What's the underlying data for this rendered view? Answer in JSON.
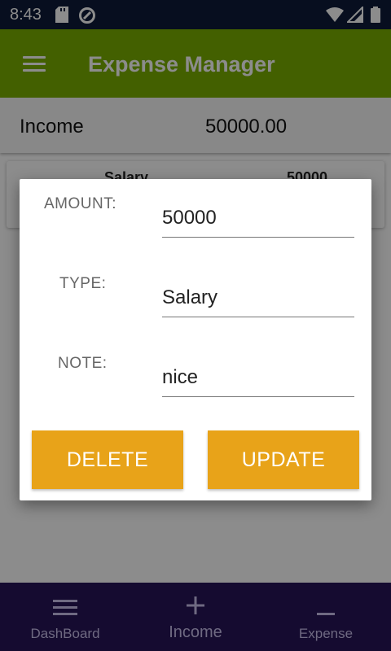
{
  "status_bar": {
    "time": "8:43",
    "icons": [
      "sd-card-icon",
      "data-saver-icon",
      "wifi-icon",
      "signal-icon",
      "battery-icon"
    ]
  },
  "app_bar": {
    "title": "Expense Manager",
    "menu_icon": "hamburger-menu-icon",
    "color": "#7bb000"
  },
  "summary": {
    "label": "Income",
    "value": "50000.00"
  },
  "entry": {
    "date": "",
    "type": "Salary",
    "amount": "50000"
  },
  "dialog": {
    "amount_label": "AMOUNT:",
    "amount_value": "50000",
    "type_label": "TYPE:",
    "type_value": "Salary",
    "note_label": "NOTE:",
    "note_value": "nice",
    "delete_label": "DELETE",
    "update_label": "UPDATE",
    "button_color": "#e8a319"
  },
  "bottom_nav": {
    "items": [
      {
        "label": "DashBoard",
        "icon": "menu-lines-icon"
      },
      {
        "label": "Income",
        "icon": "plus-icon"
      },
      {
        "label": "Expense",
        "icon": "minus-icon"
      }
    ]
  }
}
